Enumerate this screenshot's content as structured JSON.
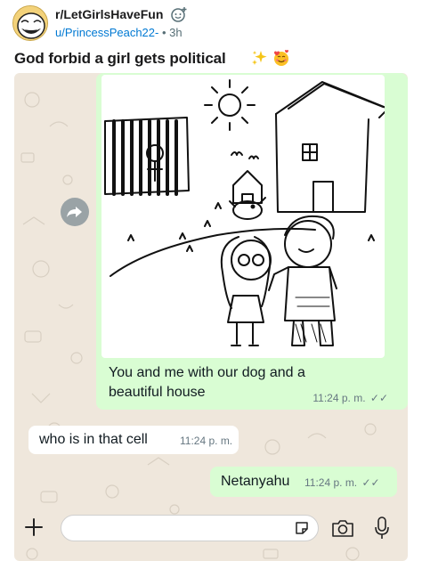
{
  "post": {
    "subreddit": "r/LetGirlsHaveFun",
    "author": "u/PrincessPeach22-",
    "separator": "•",
    "age": "3h",
    "title": "God forbid a girl gets political"
  },
  "chat": {
    "messages": [
      {
        "direction": "outgoing",
        "type": "image",
        "caption": "You and me with our dog and a beautiful house",
        "time": "11:24 p. m.",
        "status": "read"
      },
      {
        "direction": "incoming",
        "type": "text",
        "text": "who is in that cell",
        "time": "11:24 p. m."
      },
      {
        "direction": "outgoing",
        "type": "text",
        "text": "Netanyahu",
        "time": "11:24 p. m.",
        "status": "read"
      }
    ],
    "read_ticks": "✓✓"
  },
  "input_bar": {
    "placeholder": ""
  },
  "colors": {
    "outgoing_bubble": "#d9fdd3",
    "incoming_bubble": "#ffffff",
    "chat_background": "#efe7dc",
    "author_link": "#0079d3"
  }
}
